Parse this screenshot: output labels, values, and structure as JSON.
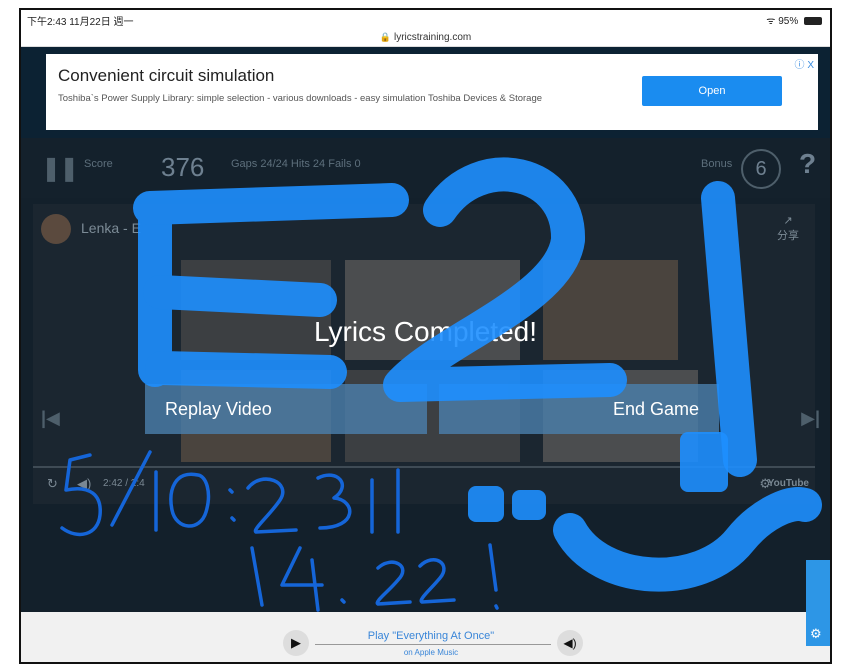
{
  "status": {
    "time_date": "下午2:43  11月22日 週一",
    "battery": "95%"
  },
  "browser": {
    "url": "lyricstraining.com"
  },
  "ad": {
    "title": "Convenient circuit simulation",
    "description": "Toshiba`s Power Supply Library: simple selection - various downloads - easy simulation Toshiba Devices & Storage",
    "button": "Open",
    "close": "ⓘ X"
  },
  "game": {
    "score_label": "Score",
    "score_value": "376",
    "gaps": "Gaps  24/24   Hits  24   Fails  0",
    "bonus_label": "Bonus",
    "bonus_value": "6",
    "help": "?"
  },
  "video": {
    "channel_title": "Lenka - E",
    "share_label": "分享",
    "time": "2:42 / 2:4"
  },
  "overlay": {
    "title": "Lyrics Completed!",
    "replay_button": "Replay Video",
    "end_button": "End Game"
  },
  "player": {
    "title": "Play \"Everything At Once\"",
    "subtitle": "on Apple Music"
  },
  "handwriting": {
    "big": "E2!",
    "line1": "5/10: 2.311",
    "line2": "14.22!"
  },
  "colors": {
    "scribble": "#1e8fff",
    "ink": "#1565d8",
    "button": "#4a7eaa"
  }
}
